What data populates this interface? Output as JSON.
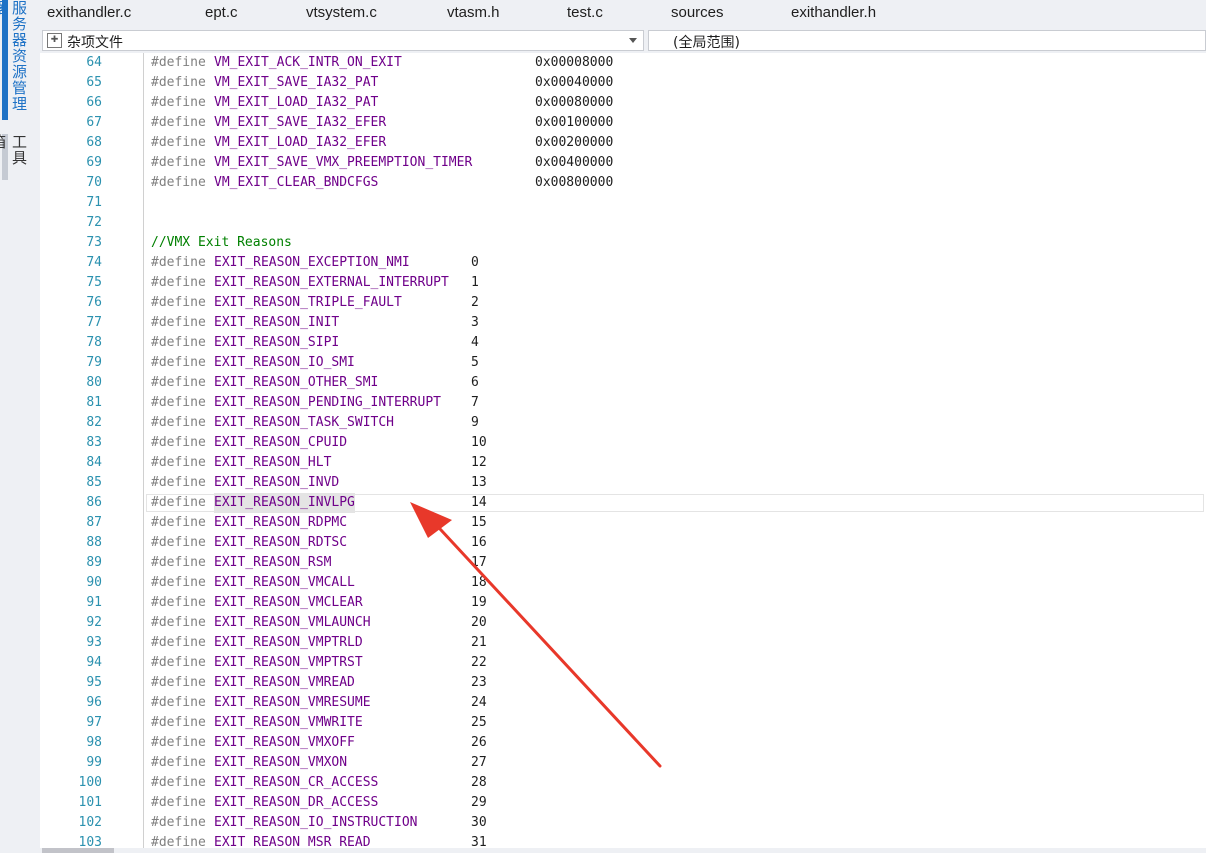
{
  "side_panel": {
    "tabs": [
      {
        "label": "服务器资源管理器",
        "active": true
      },
      {
        "label": "工具箱",
        "active": false
      }
    ]
  },
  "tabs": [
    {
      "label": "exithandler.c"
    },
    {
      "label": "ept.c"
    },
    {
      "label": "vtsystem.c"
    },
    {
      "label": "vtasm.h"
    },
    {
      "label": "test.c"
    },
    {
      "label": "sources"
    },
    {
      "label": "exithandler.h"
    }
  ],
  "navigation": {
    "scope_value": "杂项文件",
    "member_value": "(全局范围)"
  },
  "editor": {
    "current_line": 86,
    "lines": [
      {
        "n": "64",
        "kw": "#define",
        "name": "VM_EXIT_ACK_INTR_ON_EXIT",
        "value": "0x00008000"
      },
      {
        "n": "65",
        "kw": "#define",
        "name": "VM_EXIT_SAVE_IA32_PAT",
        "value": "0x00040000"
      },
      {
        "n": "66",
        "kw": "#define",
        "name": "VM_EXIT_LOAD_IA32_PAT",
        "value": "0x00080000"
      },
      {
        "n": "67",
        "kw": "#define",
        "name": "VM_EXIT_SAVE_IA32_EFER",
        "value": "0x00100000"
      },
      {
        "n": "68",
        "kw": "#define",
        "name": "VM_EXIT_LOAD_IA32_EFER",
        "value": "0x00200000"
      },
      {
        "n": "69",
        "kw": "#define",
        "name": "VM_EXIT_SAVE_VMX_PREEMPTION_TIMER",
        "value": "0x00400000"
      },
      {
        "n": "70",
        "kw": "#define",
        "name": "VM_EXIT_CLEAR_BNDCFGS",
        "value": "0x00800000"
      },
      {
        "n": "71"
      },
      {
        "n": "72"
      },
      {
        "n": "73",
        "comment": "//VMX Exit Reasons"
      },
      {
        "n": "74",
        "kw": "#define",
        "name": "EXIT_REASON_EXCEPTION_NMI",
        "value": "0"
      },
      {
        "n": "75",
        "kw": "#define",
        "name": "EXIT_REASON_EXTERNAL_INTERRUPT",
        "value": "1"
      },
      {
        "n": "76",
        "kw": "#define",
        "name": "EXIT_REASON_TRIPLE_FAULT",
        "value": "2"
      },
      {
        "n": "77",
        "kw": "#define",
        "name": "EXIT_REASON_INIT",
        "value": "3"
      },
      {
        "n": "78",
        "kw": "#define",
        "name": "EXIT_REASON_SIPI",
        "value": "4"
      },
      {
        "n": "79",
        "kw": "#define",
        "name": "EXIT_REASON_IO_SMI",
        "value": "5"
      },
      {
        "n": "80",
        "kw": "#define",
        "name": "EXIT_REASON_OTHER_SMI",
        "value": "6"
      },
      {
        "n": "81",
        "kw": "#define",
        "name": "EXIT_REASON_PENDING_INTERRUPT",
        "value": "7"
      },
      {
        "n": "82",
        "kw": "#define",
        "name": "EXIT_REASON_TASK_SWITCH",
        "value": "9"
      },
      {
        "n": "83",
        "kw": "#define",
        "name": "EXIT_REASON_CPUID",
        "value": "10"
      },
      {
        "n": "84",
        "kw": "#define",
        "name": "EXIT_REASON_HLT",
        "value": "12"
      },
      {
        "n": "85",
        "kw": "#define",
        "name": "EXIT_REASON_INVD",
        "value": "13"
      },
      {
        "n": "86",
        "kw": "#define",
        "name": "EXIT_REASON_INVLPG",
        "value": "14"
      },
      {
        "n": "87",
        "kw": "#define",
        "name": "EXIT_REASON_RDPMC",
        "value": "15"
      },
      {
        "n": "88",
        "kw": "#define",
        "name": "EXIT_REASON_RDTSC",
        "value": "16"
      },
      {
        "n": "89",
        "kw": "#define",
        "name": "EXIT_REASON_RSM",
        "value": "17"
      },
      {
        "n": "90",
        "kw": "#define",
        "name": "EXIT_REASON_VMCALL",
        "value": "18"
      },
      {
        "n": "91",
        "kw": "#define",
        "name": "EXIT_REASON_VMCLEAR",
        "value": "19"
      },
      {
        "n": "92",
        "kw": "#define",
        "name": "EXIT_REASON_VMLAUNCH",
        "value": "20"
      },
      {
        "n": "93",
        "kw": "#define",
        "name": "EXIT_REASON_VMPTRLD",
        "value": "21"
      },
      {
        "n": "94",
        "kw": "#define",
        "name": "EXIT_REASON_VMPTRST",
        "value": "22"
      },
      {
        "n": "95",
        "kw": "#define",
        "name": "EXIT_REASON_VMREAD",
        "value": "23"
      },
      {
        "n": "96",
        "kw": "#define",
        "name": "EXIT_REASON_VMRESUME",
        "value": "24"
      },
      {
        "n": "97",
        "kw": "#define",
        "name": "EXIT_REASON_VMWRITE",
        "value": "25"
      },
      {
        "n": "98",
        "kw": "#define",
        "name": "EXIT_REASON_VMXOFF",
        "value": "26"
      },
      {
        "n": "99",
        "kw": "#define",
        "name": "EXIT_REASON_VMXON",
        "value": "27"
      },
      {
        "n": "100",
        "kw": "#define",
        "name": "EXIT_REASON_CR_ACCESS",
        "value": "28"
      },
      {
        "n": "101",
        "kw": "#define",
        "name": "EXIT_REASON_DR_ACCESS",
        "value": "29"
      },
      {
        "n": "102",
        "kw": "#define",
        "name": "EXIT_REASON_IO_INSTRUCTION",
        "value": "30"
      },
      {
        "n": "103",
        "kw": "#define",
        "name": "EXIT_REASON_MSR_READ",
        "value": "31"
      }
    ]
  },
  "colors": {
    "line_number": "#2b91af",
    "keyword": "#808080",
    "macro": "#6f008a",
    "comment": "#008000",
    "arrow": "#e8382a"
  }
}
